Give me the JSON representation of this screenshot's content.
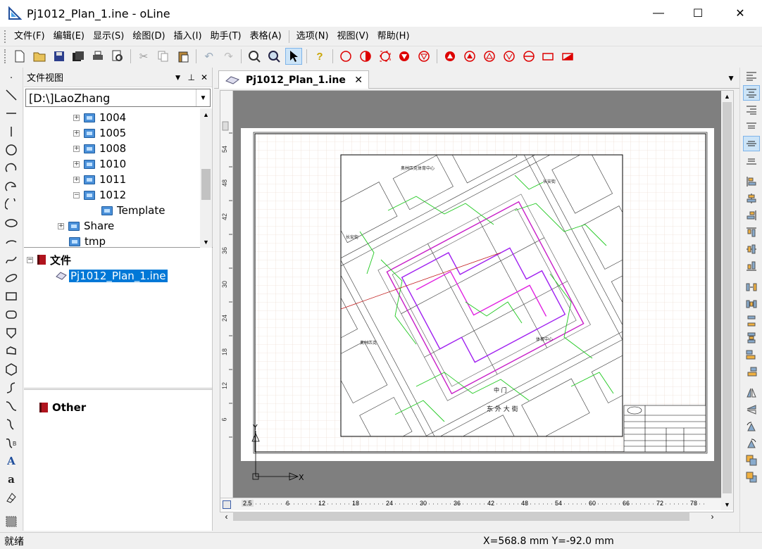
{
  "window": {
    "title": "Pj1012_Plan_1.ine - oLine",
    "minimize": "—",
    "maximize": "☐",
    "close": "✕"
  },
  "menu": [
    "文件(F)",
    "编辑(E)",
    "显示(S)",
    "绘图(D)",
    "插入(I)",
    "助手(T)",
    "表格(A)",
    "选项(N)",
    "视图(V)",
    "帮助(H)"
  ],
  "file_panel": {
    "title": "文件视图",
    "path": "[D:\\]LaoZhang",
    "tree": [
      {
        "label": "1004",
        "expand": "+",
        "indent": 1
      },
      {
        "label": "1005",
        "expand": "+",
        "indent": 1
      },
      {
        "label": "1008",
        "expand": "+",
        "indent": 1
      },
      {
        "label": "1010",
        "expand": "+",
        "indent": 1
      },
      {
        "label": "1011",
        "expand": "+",
        "indent": 1
      },
      {
        "label": "1012",
        "expand": "−",
        "indent": 1
      },
      {
        "label": "Template",
        "expand": "",
        "indent": 2
      },
      {
        "label": "Share",
        "expand": "+",
        "indent": 0
      },
      {
        "label": "tmp",
        "expand": "",
        "indent": 0
      }
    ],
    "files_group": "文件",
    "files": [
      "Pj1012_Plan_1.ine"
    ],
    "other_group": "Other"
  },
  "document": {
    "tab_label": "Pj1012_Plan_1.ine",
    "tab_close": "✕",
    "axis_y": "Y",
    "axis_x": "X",
    "vruler_labels": [
      "54",
      "48",
      "42",
      "36",
      "30",
      "24",
      "18",
      "12",
      "6"
    ],
    "hruler_labels": [
      "2.5",
      "6",
      "12",
      "18",
      "24",
      "30",
      "36",
      "42",
      "48",
      "54",
      "60",
      "66",
      "72",
      "78"
    ],
    "drawing_texts": [
      "奥林匹克体育中心",
      "长安街"
    ]
  },
  "status": {
    "text": "就绪",
    "coords": "X=568.8 mm  Y=-92.0 mm"
  }
}
